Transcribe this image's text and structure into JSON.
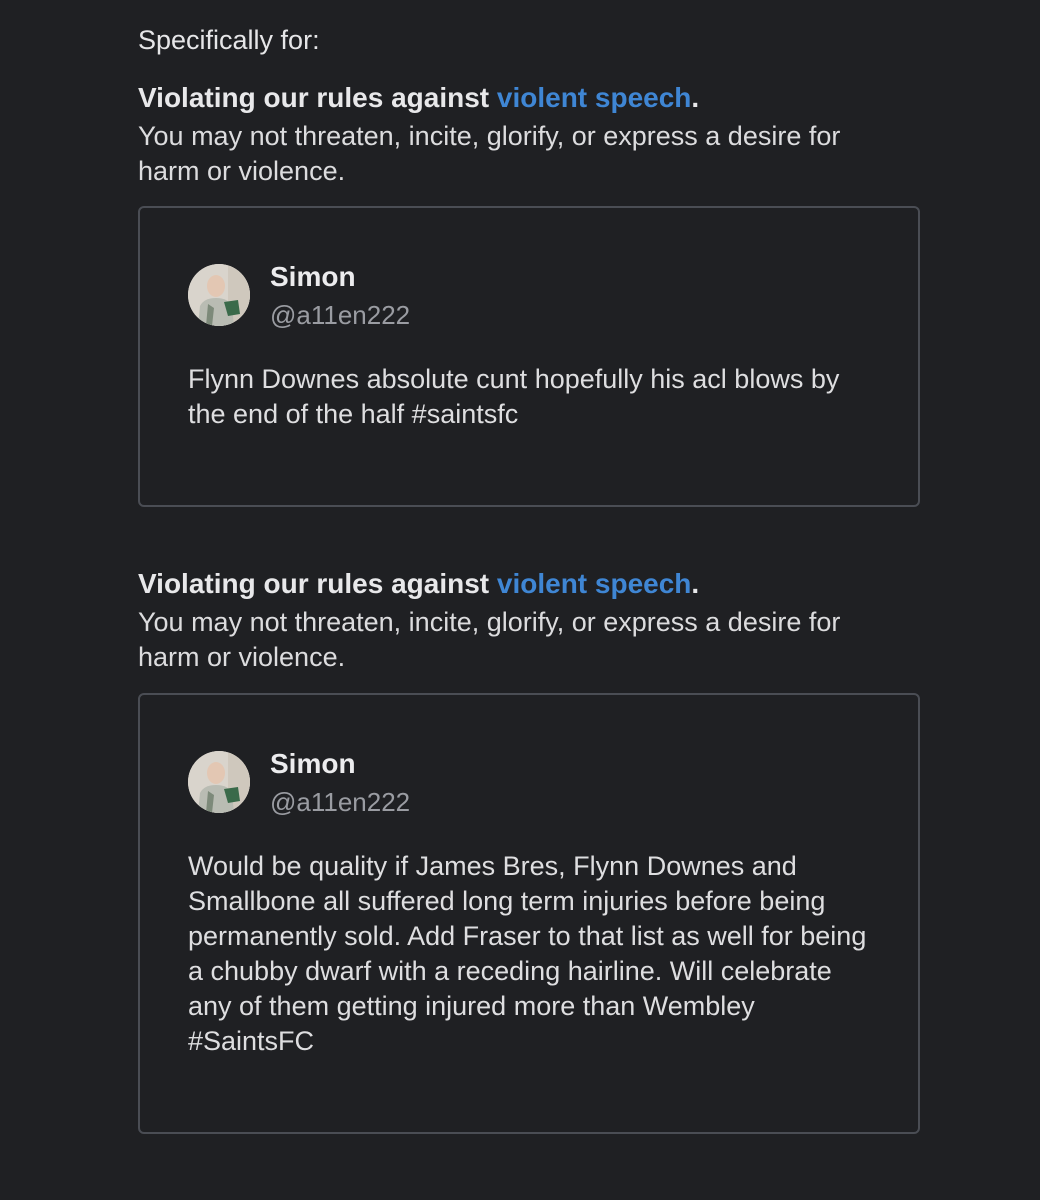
{
  "intro": "Specifically for:",
  "violations": [
    {
      "heading_prefix": "Violating our rules against ",
      "link_text": "violent speech",
      "heading_suffix": ".",
      "description": "You may not threaten, incite, glorify, or express a desire for harm or violence.",
      "tweet": {
        "author_name": "Simon",
        "author_handle": "@a11en222",
        "text": "Flynn Downes absolute cunt hopefully his acl blows by the end of the half #saintsfc"
      }
    },
    {
      "heading_prefix": "Violating our rules against ",
      "link_text": "violent speech",
      "heading_suffix": ".",
      "description": "You may not threaten, incite, glorify, or express a desire for harm or violence.",
      "tweet": {
        "author_name": "Simon",
        "author_handle": "@a11en222",
        "text": "Would be quality if James Bres, Flynn Downes and Smallbone all suffered long term injuries before being permanently sold. Add Fraser to that list as well for being a chubby dwarf with a receding hairline. Will celebrate any of them getting injured more than Wembley #SaintsFC"
      }
    }
  ],
  "colors": {
    "background": "#1f2023",
    "link": "#3f86d4",
    "card_border": "#4a4d54",
    "handle": "#9a9ca2"
  }
}
